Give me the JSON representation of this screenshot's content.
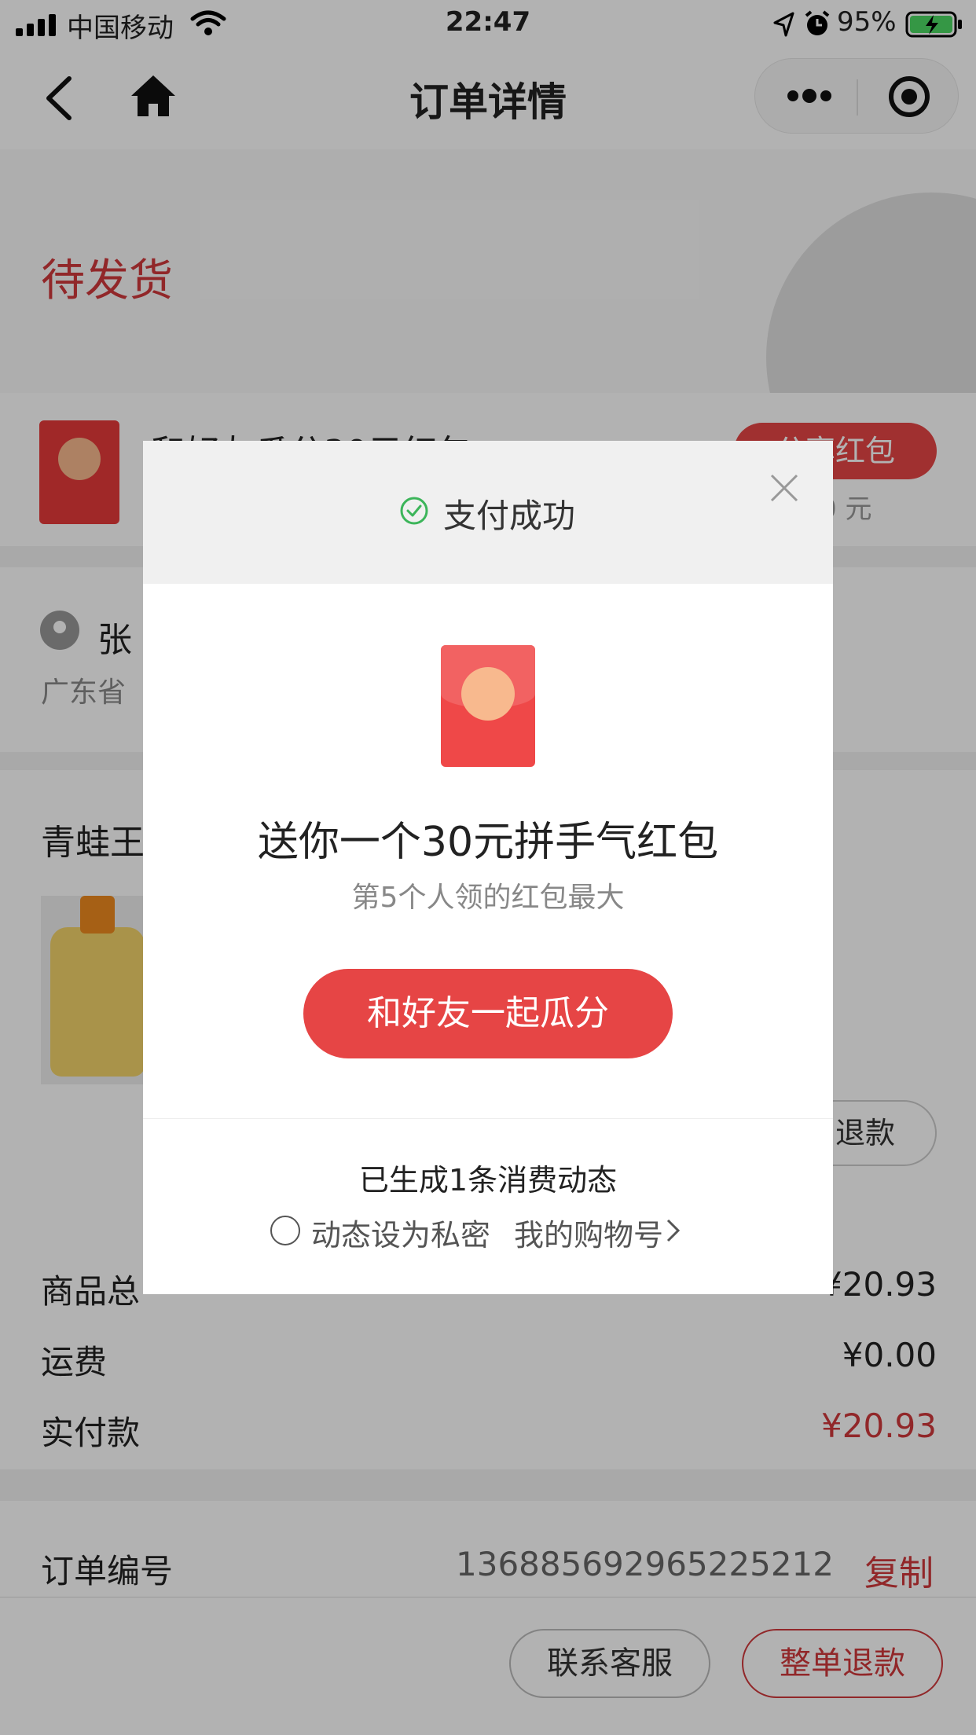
{
  "status_bar": {
    "carrier": "中国移动",
    "time": "22:47",
    "battery": "95%"
  },
  "nav": {
    "title": "订单详情"
  },
  "order_status": "待发货",
  "red_packet_row": {
    "title": "和好友瓜分30元红包",
    "button": "分享红包",
    "progress": "/30 元"
  },
  "address": {
    "name": "张",
    "line": "广东省"
  },
  "goods": {
    "shop": "青蛙王",
    "refund_label": "退款"
  },
  "summary": [
    {
      "label": "商品总",
      "value": "¥20.93"
    },
    {
      "label": "运费",
      "value": "¥0.00"
    },
    {
      "label": "实付款",
      "value": "¥20.93"
    }
  ],
  "order": {
    "label": "订单编号",
    "number": "1368856929652252​12",
    "copy": "复制"
  },
  "bottom": {
    "service": "联系客服",
    "refund_all": "整单退款"
  },
  "modal": {
    "title": "支付成功",
    "headline": "送你一个30元拼手气红包",
    "subtitle": "第5个人领的红包最大",
    "cta": "和好友一起瓜分",
    "feed": "已生成1条消费动态",
    "private_label": "动态设为私密",
    "shop_no": "我的购物号"
  },
  "colors": {
    "accent_red": "#e64545",
    "status_red": "#d0383b",
    "success_green": "#3cb55a"
  }
}
